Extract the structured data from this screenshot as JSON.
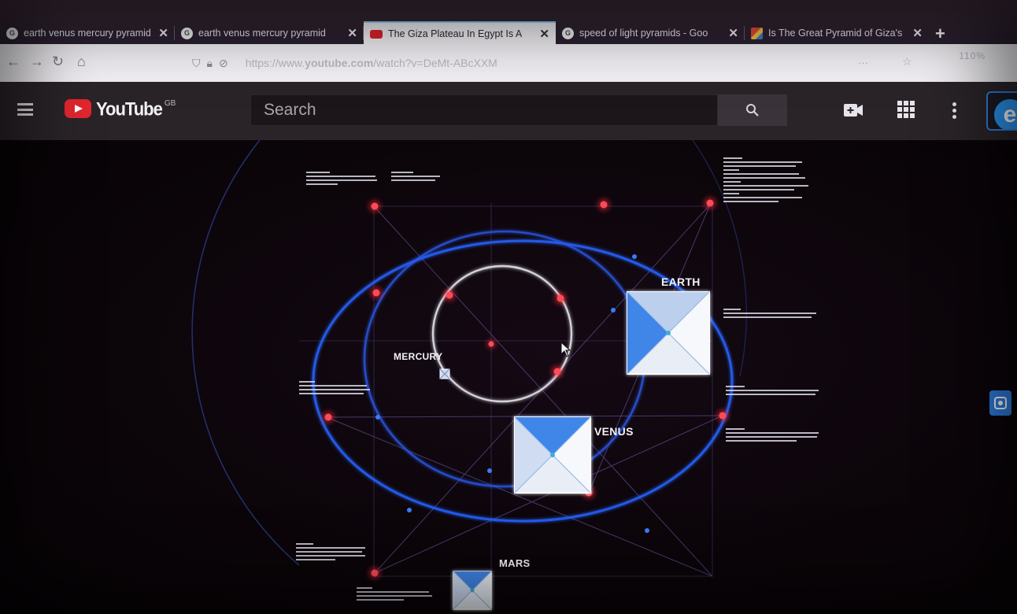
{
  "browser": {
    "tabs": [
      {
        "title": "earth venus mercury pyramid",
        "favicon": "google-icon",
        "active": false
      },
      {
        "title": "earth venus mercury pyramid",
        "favicon": "google-icon",
        "active": false
      },
      {
        "title": "The Giza Plateau In Egypt Is A",
        "favicon": "youtube-icon",
        "active": true
      },
      {
        "title": "speed of light pyramids - Goo",
        "favicon": "google-icon",
        "active": false
      },
      {
        "title": "Is The Great Pyramid of Giza's",
        "favicon": "image-icon",
        "active": false
      }
    ],
    "new_tab_label": "+",
    "url_prefix": "https://www.",
    "url_domain": "youtube.com",
    "url_rest": "/watch?v=DeMt-ABcXXM",
    "url_right_text": "110%"
  },
  "youtube": {
    "logo_text": "YouTube",
    "region": "GB",
    "search_placeholder": "Search",
    "avatar_letter": "e"
  },
  "video": {
    "planets": {
      "earth": "EARTH",
      "venus": "VENUS",
      "mercury": "MERCURY",
      "mars": "MARS"
    },
    "colors": {
      "orbit": "#2563ff",
      "mercury_orbit": "#e8e8f0",
      "node": "#ff2a3a",
      "pyramid_face_light": "#e9eef6",
      "pyramid_face_blue": "#3f86e8"
    }
  }
}
